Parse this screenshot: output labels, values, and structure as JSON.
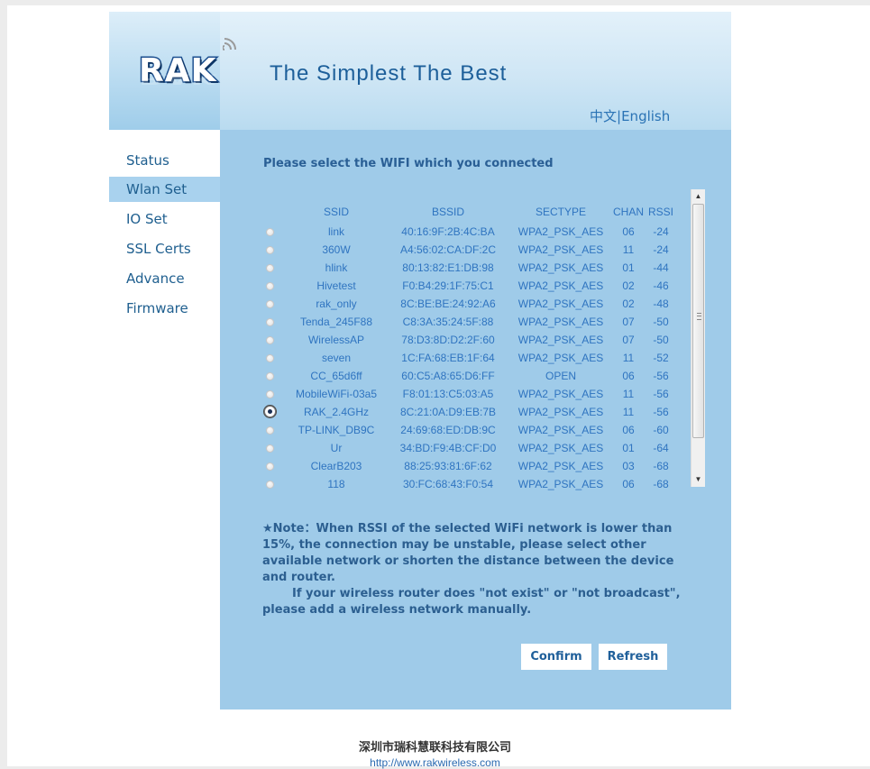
{
  "header": {
    "logo_text": "RAK",
    "slogan": "The  Simplest  The  Best",
    "lang_cn": "中文",
    "lang_sep": "|",
    "lang_en": "English"
  },
  "sidebar": {
    "items": [
      {
        "label": "Status",
        "active": false
      },
      {
        "label": "Wlan Set",
        "active": true
      },
      {
        "label": "IO Set",
        "active": false
      },
      {
        "label": "SSL Certs",
        "active": false
      },
      {
        "label": "Advance",
        "active": false
      },
      {
        "label": "Firmware",
        "active": false
      }
    ]
  },
  "main": {
    "title": "Please select the WIFI which you connected",
    "columns": {
      "ssid": "SSID",
      "bssid": "BSSID",
      "sectype": "SECTYPE",
      "chan": "CHAN",
      "rssi": "RSSI"
    },
    "networks": [
      {
        "ssid": "link",
        "bssid": "40:16:9F:2B:4C:BA",
        "sectype": "WPA2_PSK_AES",
        "chan": "06",
        "rssi": "-24",
        "selected": false
      },
      {
        "ssid": "360W",
        "bssid": "A4:56:02:CA:DF:2C",
        "sectype": "WPA2_PSK_AES",
        "chan": "11",
        "rssi": "-24",
        "selected": false
      },
      {
        "ssid": "hlink",
        "bssid": "80:13:82:E1:DB:98",
        "sectype": "WPA2_PSK_AES",
        "chan": "01",
        "rssi": "-44",
        "selected": false
      },
      {
        "ssid": "Hivetest",
        "bssid": "F0:B4:29:1F:75:C1",
        "sectype": "WPA2_PSK_AES",
        "chan": "02",
        "rssi": "-46",
        "selected": false
      },
      {
        "ssid": "rak_only",
        "bssid": "8C:BE:BE:24:92:A6",
        "sectype": "WPA2_PSK_AES",
        "chan": "02",
        "rssi": "-48",
        "selected": false
      },
      {
        "ssid": "Tenda_245F88",
        "bssid": "C8:3A:35:24:5F:88",
        "sectype": "WPA2_PSK_AES",
        "chan": "07",
        "rssi": "-50",
        "selected": false
      },
      {
        "ssid": "WirelessAP",
        "bssid": "78:D3:8D:D2:2F:60",
        "sectype": "WPA2_PSK_AES",
        "chan": "07",
        "rssi": "-50",
        "selected": false
      },
      {
        "ssid": "seven",
        "bssid": "1C:FA:68:EB:1F:64",
        "sectype": "WPA2_PSK_AES",
        "chan": "11",
        "rssi": "-52",
        "selected": false
      },
      {
        "ssid": "CC_65d6ff",
        "bssid": "60:C5:A8:65:D6:FF",
        "sectype": "OPEN",
        "chan": "06",
        "rssi": "-56",
        "selected": false
      },
      {
        "ssid": "MobileWiFi-03a5",
        "bssid": "F8:01:13:C5:03:A5",
        "sectype": "WPA2_PSK_AES",
        "chan": "11",
        "rssi": "-56",
        "selected": false
      },
      {
        "ssid": "RAK_2.4GHz",
        "bssid": "8C:21:0A:D9:EB:7B",
        "sectype": "WPA2_PSK_AES",
        "chan": "11",
        "rssi": "-56",
        "selected": true
      },
      {
        "ssid": "TP-LINK_DB9C",
        "bssid": "24:69:68:ED:DB:9C",
        "sectype": "WPA2_PSK_AES",
        "chan": "06",
        "rssi": "-60",
        "selected": false
      },
      {
        "ssid": "Ur",
        "bssid": "34:BD:F9:4B:CF:D0",
        "sectype": "WPA2_PSK_AES",
        "chan": "01",
        "rssi": "-64",
        "selected": false
      },
      {
        "ssid": "ClearB203",
        "bssid": "88:25:93:81:6F:62",
        "sectype": "WPA2_PSK_AES",
        "chan": "03",
        "rssi": "-68",
        "selected": false
      },
      {
        "ssid": "118",
        "bssid": "30:FC:68:43:F0:54",
        "sectype": "WPA2_PSK_AES",
        "chan": "06",
        "rssi": "-68",
        "selected": false
      }
    ],
    "note_line1": "★Note：When RSSI of the selected WiFi network is lower than 15%,  the connection may be unstable,  please select other available network or shorten the distance between the device and router.",
    "note_line2": "If your wireless router does \"not exist\" or \"not broadcast\", please add a wireless network manually.",
    "confirm_label": "Confirm",
    "refresh_label": "Refresh"
  },
  "footer": {
    "company": "深圳市瑞科慧联科技有限公司",
    "url": "http://www.rakwireless.com"
  },
  "colors": {
    "content_bg": "#9fcbe9",
    "active_nav_bg": "#a9d2ee",
    "list_text": "#2f74c0",
    "title_text": "#2a5f95"
  }
}
